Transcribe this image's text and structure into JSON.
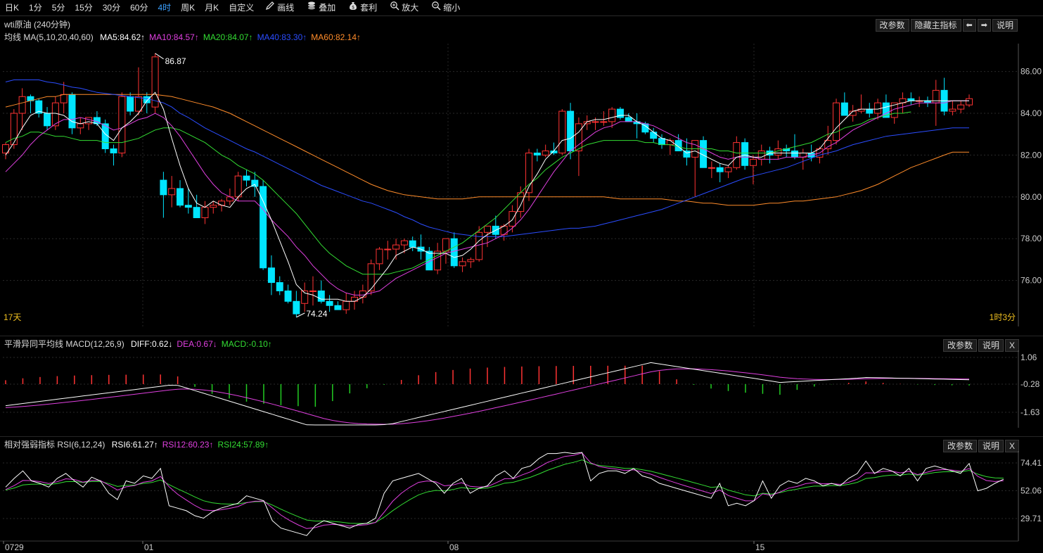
{
  "toolbar": {
    "periods": [
      "日K",
      "1分",
      "5分",
      "15分",
      "30分",
      "60分",
      "4时",
      "周K",
      "月K",
      "自定义"
    ],
    "active_period": "4时",
    "tools": [
      {
        "label": "画线",
        "icon": "pencil-icon"
      },
      {
        "label": "叠加",
        "icon": "layers-icon"
      },
      {
        "label": "套利",
        "icon": "money-bag-icon"
      },
      {
        "label": "放大",
        "icon": "zoom-in-icon"
      },
      {
        "label": "缩小",
        "icon": "zoom-out-icon"
      }
    ]
  },
  "main": {
    "title": "wti原油 (240分钟)",
    "buttons": {
      "params": "改参数",
      "hide": "隐藏主指标",
      "prev": "⬅",
      "next": "➡",
      "help": "说明"
    },
    "ma_legend": {
      "name": "均线 MA(5,10,20,40,60)",
      "items": [
        {
          "text": "MA5:84.62↑",
          "color": "#ffffff"
        },
        {
          "text": "MA10:84.57↑",
          "color": "#e040e0"
        },
        {
          "text": "MA20:84.07↑",
          "color": "#33dd33"
        },
        {
          "text": "MA40:83.30↑",
          "color": "#2b4dff"
        },
        {
          "text": "MA60:82.14↑",
          "color": "#ff8c2a"
        }
      ]
    },
    "y_ticks": [
      "86.00",
      "84.00",
      "82.00",
      "80.00",
      "78.00",
      "76.00"
    ],
    "high_label": "86.87",
    "low_label": "74.24",
    "left_note": "17天",
    "right_note": "1时3分"
  },
  "macd": {
    "name": "平滑异同平均线 MACD(12,26,9)",
    "items": [
      {
        "text": "DIFF:0.62↓",
        "color": "#ffffff"
      },
      {
        "text": "DEA:0.67↓",
        "color": "#e040e0"
      },
      {
        "text": "MACD:-0.10↑",
        "color": "#33dd33"
      }
    ],
    "buttons": {
      "params": "改参数",
      "help": "说明",
      "close": "X"
    },
    "y_ticks": [
      "1.06",
      "-0.28",
      "-1.63"
    ]
  },
  "rsi": {
    "name": "相对强弱指标 RSI(6,12,24)",
    "items": [
      {
        "text": "RSI6:61.27↑",
        "color": "#ffffff"
      },
      {
        "text": "RSI12:60.23↑",
        "color": "#e040e0"
      },
      {
        "text": "RSI24:57.89↑",
        "color": "#33dd33"
      }
    ],
    "buttons": {
      "params": "改参数",
      "help": "说明",
      "close": "X"
    },
    "y_ticks": [
      "74.41",
      "52.06",
      "29.71"
    ]
  },
  "x_labels": [
    "0729",
    "01",
    "08",
    "15"
  ],
  "colors": {
    "up": "#ff3333",
    "down": "#00e5ff",
    "ma5": "#ffffff",
    "ma10": "#e040e0",
    "ma20": "#33dd33",
    "ma40": "#2b4dff",
    "ma60": "#ff8c2a"
  },
  "chart_data": {
    "type": "candlestick",
    "y_range": [
      74.0,
      87.2
    ],
    "candles": [
      [
        82.1,
        82.6,
        81.8,
        82.5
      ],
      [
        82.5,
        84.2,
        82.3,
        84.0
      ],
      [
        84.0,
        85.2,
        83.2,
        84.8
      ],
      [
        84.8,
        84.9,
        84.0,
        84.6
      ],
      [
        84.6,
        84.7,
        83.8,
        84.0
      ],
      [
        84.0,
        84.3,
        83.2,
        83.4
      ],
      [
        83.4,
        84.8,
        83.2,
        84.5
      ],
      [
        84.5,
        85.5,
        84.0,
        84.9
      ],
      [
        84.9,
        85.0,
        83.0,
        83.3
      ],
      [
        83.3,
        83.8,
        83.0,
        83.5
      ],
      [
        83.5,
        83.8,
        83.2,
        83.8
      ],
      [
        83.8,
        84.1,
        83.4,
        83.5
      ],
      [
        83.5,
        83.7,
        82.1,
        82.3
      ],
      [
        82.3,
        82.5,
        81.5,
        82.1
      ],
      [
        82.1,
        85.0,
        81.9,
        84.8
      ],
      [
        84.8,
        85.0,
        83.9,
        84.1
      ],
      [
        84.1,
        86.2,
        83.9,
        84.8
      ],
      [
        84.8,
        85.0,
        84.0,
        84.5
      ],
      [
        84.3,
        86.87,
        84.0,
        86.7
      ],
      [
        80.8,
        81.2,
        79.0,
        80.1
      ],
      [
        80.1,
        81.0,
        79.5,
        80.4
      ],
      [
        80.4,
        80.8,
        79.5,
        79.6
      ],
      [
        79.6,
        80.4,
        79.2,
        79.5
      ],
      [
        79.5,
        80.1,
        79.0,
        79.0
      ],
      [
        79.0,
        79.8,
        78.7,
        79.5
      ],
      [
        79.5,
        79.8,
        79.2,
        79.6
      ],
      [
        79.6,
        79.9,
        79.3,
        79.8
      ],
      [
        79.8,
        80.4,
        79.6,
        80.0
      ],
      [
        80.0,
        81.2,
        79.8,
        81.0
      ],
      [
        81.0,
        81.3,
        80.5,
        80.8
      ],
      [
        80.8,
        81.2,
        80.0,
        80.5
      ],
      [
        80.5,
        80.8,
        76.5,
        76.6
      ],
      [
        76.6,
        77.2,
        75.3,
        75.9
      ],
      [
        75.9,
        76.2,
        75.3,
        75.5
      ],
      [
        75.5,
        75.8,
        74.9,
        75.0
      ],
      [
        75.0,
        75.5,
        74.24,
        74.4
      ],
      [
        74.9,
        75.9,
        74.5,
        75.5
      ],
      [
        75.5,
        76.2,
        74.8,
        75.5
      ],
      [
        75.5,
        76.0,
        74.9,
        75.0
      ],
      [
        75.0,
        75.3,
        74.5,
        74.8
      ],
      [
        74.8,
        75.0,
        74.6,
        74.6
      ],
      [
        74.6,
        75.4,
        74.4,
        75.0
      ],
      [
        75.0,
        75.5,
        74.6,
        75.2
      ],
      [
        75.2,
        75.8,
        74.9,
        75.5
      ],
      [
        75.5,
        77.0,
        75.3,
        76.8
      ],
      [
        76.8,
        77.6,
        76.5,
        77.5
      ],
      [
        77.5,
        77.9,
        77.0,
        77.5
      ],
      [
        77.5,
        78.0,
        77.0,
        77.7
      ],
      [
        77.7,
        78.0,
        77.3,
        77.9
      ],
      [
        77.9,
        78.1,
        77.4,
        77.6
      ],
      [
        77.6,
        78.2,
        77.0,
        77.4
      ],
      [
        77.4,
        77.6,
        76.6,
        76.5
      ],
      [
        76.5,
        77.8,
        76.3,
        77.4
      ],
      [
        77.4,
        78.0,
        76.8,
        78.0
      ],
      [
        78.0,
        78.3,
        76.6,
        76.7
      ],
      [
        76.7,
        77.1,
        76.4,
        76.9
      ],
      [
        76.9,
        77.1,
        76.6,
        77.0
      ],
      [
        77.0,
        78.6,
        76.9,
        78.3
      ],
      [
        78.3,
        78.6,
        77.6,
        78.6
      ],
      [
        78.6,
        79.1,
        78.0,
        78.2
      ],
      [
        78.2,
        78.7,
        77.9,
        78.6
      ],
      [
        78.6,
        79.6,
        78.3,
        79.3
      ],
      [
        79.3,
        80.5,
        79.0,
        80.2
      ],
      [
        80.2,
        82.3,
        79.8,
        82.1
      ],
      [
        82.1,
        82.3,
        81.7,
        82.0
      ],
      [
        82.0,
        82.5,
        81.9,
        82.2
      ],
      [
        82.2,
        82.6,
        82.0,
        82.1
      ],
      [
        82.1,
        84.2,
        82.0,
        84.1
      ],
      [
        84.1,
        84.5,
        81.8,
        82.2
      ],
      [
        82.2,
        83.8,
        81.0,
        83.5
      ],
      [
        83.5,
        83.9,
        83.2,
        83.6
      ],
      [
        83.6,
        83.8,
        83.2,
        83.6
      ],
      [
        83.6,
        84.1,
        83.4,
        83.6
      ],
      [
        83.6,
        84.3,
        83.3,
        84.2
      ],
      [
        84.2,
        84.3,
        83.7,
        83.8
      ],
      [
        83.8,
        84.0,
        83.7,
        83.6
      ],
      [
        83.6,
        84.0,
        82.8,
        83.5
      ],
      [
        83.5,
        83.6,
        83.0,
        83.1
      ],
      [
        83.1,
        83.3,
        82.6,
        82.8
      ],
      [
        82.8,
        83.0,
        82.3,
        82.5
      ],
      [
        82.5,
        82.8,
        82.0,
        82.7
      ],
      [
        82.7,
        83.0,
        82.2,
        82.2
      ],
      [
        82.2,
        82.8,
        81.5,
        81.9
      ],
      [
        81.9,
        82.7,
        80.0,
        82.7
      ],
      [
        82.7,
        82.9,
        81.8,
        81.4
      ],
      [
        81.4,
        81.7,
        80.9,
        81.4
      ],
      [
        81.4,
        81.6,
        80.7,
        81.2
      ],
      [
        81.2,
        81.5,
        80.9,
        81.4
      ],
      [
        81.4,
        82.9,
        81.3,
        82.6
      ],
      [
        82.6,
        82.8,
        81.3,
        81.5
      ],
      [
        81.5,
        82.0,
        80.6,
        81.8
      ],
      [
        81.8,
        82.5,
        81.5,
        82.2
      ],
      [
        82.2,
        82.4,
        81.6,
        82.0
      ],
      [
        82.0,
        82.7,
        81.8,
        82.3
      ],
      [
        82.3,
        82.5,
        81.9,
        82.2
      ],
      [
        82.2,
        83.0,
        81.8,
        81.9
      ],
      [
        81.9,
        82.3,
        81.3,
        82.1
      ],
      [
        82.1,
        82.5,
        81.7,
        81.9
      ],
      [
        81.9,
        82.4,
        81.6,
        82.3
      ],
      [
        82.3,
        83.4,
        82.0,
        82.7
      ],
      [
        82.7,
        84.7,
        82.5,
        84.5
      ],
      [
        84.5,
        85.0,
        84.0,
        83.9
      ],
      [
        83.9,
        84.4,
        83.6,
        84.1
      ],
      [
        84.1,
        84.9,
        84.0,
        84.2
      ],
      [
        84.2,
        84.5,
        83.8,
        84.0
      ],
      [
        84.0,
        84.7,
        83.7,
        84.5
      ],
      [
        84.5,
        84.9,
        83.9,
        83.8
      ],
      [
        83.8,
        84.4,
        83.5,
        84.5
      ],
      [
        84.5,
        85.0,
        84.0,
        84.7
      ],
      [
        84.7,
        85.0,
        84.4,
        84.6
      ],
      [
        84.6,
        84.8,
        84.3,
        84.6
      ],
      [
        84.6,
        84.8,
        84.3,
        84.5
      ],
      [
        84.5,
        85.6,
        83.4,
        85.1
      ],
      [
        85.1,
        85.7,
        83.9,
        84.1
      ],
      [
        84.1,
        84.6,
        83.9,
        84.2
      ],
      [
        84.2,
        84.6,
        84.0,
        84.4
      ],
      [
        84.4,
        84.9,
        84.3,
        84.7
      ]
    ],
    "ma5": [
      82.0,
      82.6,
      83.3,
      83.9,
      84.1,
      84.0,
      84.0,
      83.9,
      83.6,
      83.5,
      83.6,
      83.5,
      83.0,
      82.7,
      83.3,
      83.6,
      84.0,
      84.6,
      85.0,
      84.2,
      82.8,
      81.5,
      80.4,
      79.7,
      79.5,
      79.8,
      79.6,
      79.5,
      80.0,
      80.4,
      80.6,
      79.8,
      78.9,
      77.9,
      76.9,
      75.8,
      75.4,
      75.3,
      75.1,
      75.1,
      75.1,
      75.0,
      75.0,
      75.2,
      75.6,
      76.1,
      76.6,
      77.2,
      77.4,
      77.6,
      77.5,
      77.3,
      77.3,
      77.3,
      77.1,
      77.2,
      77.5,
      77.9,
      78.2,
      78.4,
      78.6,
      78.9,
      79.6,
      80.5,
      81.1,
      81.8,
      82.2,
      82.7,
      82.8,
      83.1,
      83.6,
      83.7,
      83.7,
      83.8,
      83.9,
      83.9,
      83.6,
      83.4,
      83.1,
      82.8,
      82.7,
      82.4,
      82.1,
      82.2,
      82.0,
      81.8,
      81.6,
      81.5,
      81.9,
      82.0,
      81.9,
      81.9,
      82.1,
      82.1,
      82.1,
      82.1,
      82.1,
      82.1,
      82.3,
      82.8,
      83.3,
      83.7,
      84.1,
      84.2,
      84.2,
      84.2,
      84.3,
      84.4,
      84.5,
      84.6,
      84.6,
      84.6,
      84.6,
      84.6,
      84.6,
      84.6,
      84.6
    ],
    "ma10": [
      81.2,
      81.6,
      82.0,
      82.5,
      82.9,
      83.2,
      83.5,
      83.7,
      83.7,
      83.8,
      83.7,
      83.6,
      83.4,
      83.2,
      83.3,
      83.5,
      83.7,
      83.8,
      84.0,
      83.8,
      83.4,
      82.9,
      82.3,
      81.7,
      81.1,
      80.6,
      80.2,
      80.0,
      79.8,
      79.8,
      79.8,
      79.4,
      78.9,
      78.5,
      78.1,
      77.6,
      77.2,
      76.7,
      76.3,
      75.9,
      75.6,
      75.4,
      75.3,
      75.3,
      75.4,
      75.5,
      75.8,
      76.1,
      76.3,
      76.5,
      76.7,
      76.9,
      77.1,
      77.3,
      77.4,
      77.5,
      77.6,
      77.7,
      77.8,
      78.0,
      78.2,
      78.5,
      78.9,
      79.4,
      80.0,
      80.6,
      81.2,
      81.7,
      82.2,
      82.5,
      82.8,
      83.1,
      83.3,
      83.4,
      83.6,
      83.6,
      83.6,
      83.5,
      83.4,
      83.2,
      83.0,
      82.8,
      82.6,
      82.5,
      82.3,
      82.1,
      81.9,
      81.8,
      81.9,
      81.9,
      81.9,
      81.8,
      81.8,
      81.8,
      81.9,
      81.9,
      81.9,
      82.0,
      82.1,
      82.4,
      82.6,
      82.9,
      83.2,
      83.4,
      83.6,
      83.8,
      84.0,
      84.2,
      84.3,
      84.4,
      84.5,
      84.5,
      84.5,
      84.5,
      84.6,
      84.6,
      84.6
    ],
    "ma20": [
      82.6,
      82.8,
      82.9,
      83.1,
      83.1,
      83.0,
      82.9,
      82.9,
      82.8,
      82.7,
      82.7,
      82.7,
      82.6,
      82.6,
      82.6,
      82.7,
      82.8,
      83.0,
      83.2,
      83.3,
      83.3,
      83.2,
      83.0,
      82.8,
      82.6,
      82.3,
      82.0,
      81.8,
      81.5,
      81.3,
      81.1,
      80.8,
      80.4,
      80.0,
      79.6,
      79.2,
      78.7,
      78.2,
      77.7,
      77.3,
      77.0,
      76.7,
      76.5,
      76.3,
      76.3,
      76.3,
      76.3,
      76.4,
      76.5,
      76.6,
      76.8,
      77.0,
      77.2,
      77.4,
      77.6,
      77.8,
      78.1,
      78.4,
      78.7,
      79.0,
      79.4,
      79.8,
      80.2,
      80.6,
      80.9,
      81.3,
      81.6,
      81.9,
      82.1,
      82.3,
      82.5,
      82.6,
      82.7,
      82.7,
      82.7,
      82.7,
      82.7,
      82.6,
      82.6,
      82.5,
      82.5,
      82.4,
      82.3,
      82.3,
      82.3,
      82.3,
      82.2,
      82.2,
      82.1,
      82.1,
      82.1,
      82.1,
      82.1,
      82.2,
      82.3,
      82.4,
      82.5,
      82.6,
      82.8,
      83.0,
      83.1,
      83.3,
      83.4,
      83.5,
      83.7,
      83.8,
      83.9,
      84.0,
      84.0,
      84.07
    ]
  }
}
